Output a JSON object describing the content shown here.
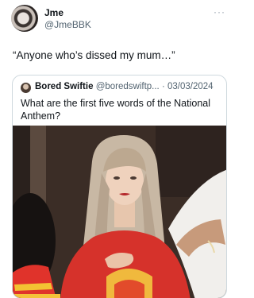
{
  "author": {
    "name": "Jme",
    "handle": "@JmeBBK"
  },
  "tweet": {
    "text": "“Anyone who’s dissed my mum…”"
  },
  "quoted": {
    "name": "Bored Swiftie",
    "handle": "@boredswiftp...",
    "separator": "·",
    "date": "03/03/2024",
    "text": "What are the first five words of the National Anthem?"
  },
  "menu": {
    "more": "···"
  },
  "colors": {
    "text": "#0f1419",
    "secondary": "#536471",
    "border": "#cfd9de",
    "sweater_red": "#d6322b"
  },
  "icons": [
    "avatar",
    "more-options-icon",
    "quoted-avatar"
  ]
}
